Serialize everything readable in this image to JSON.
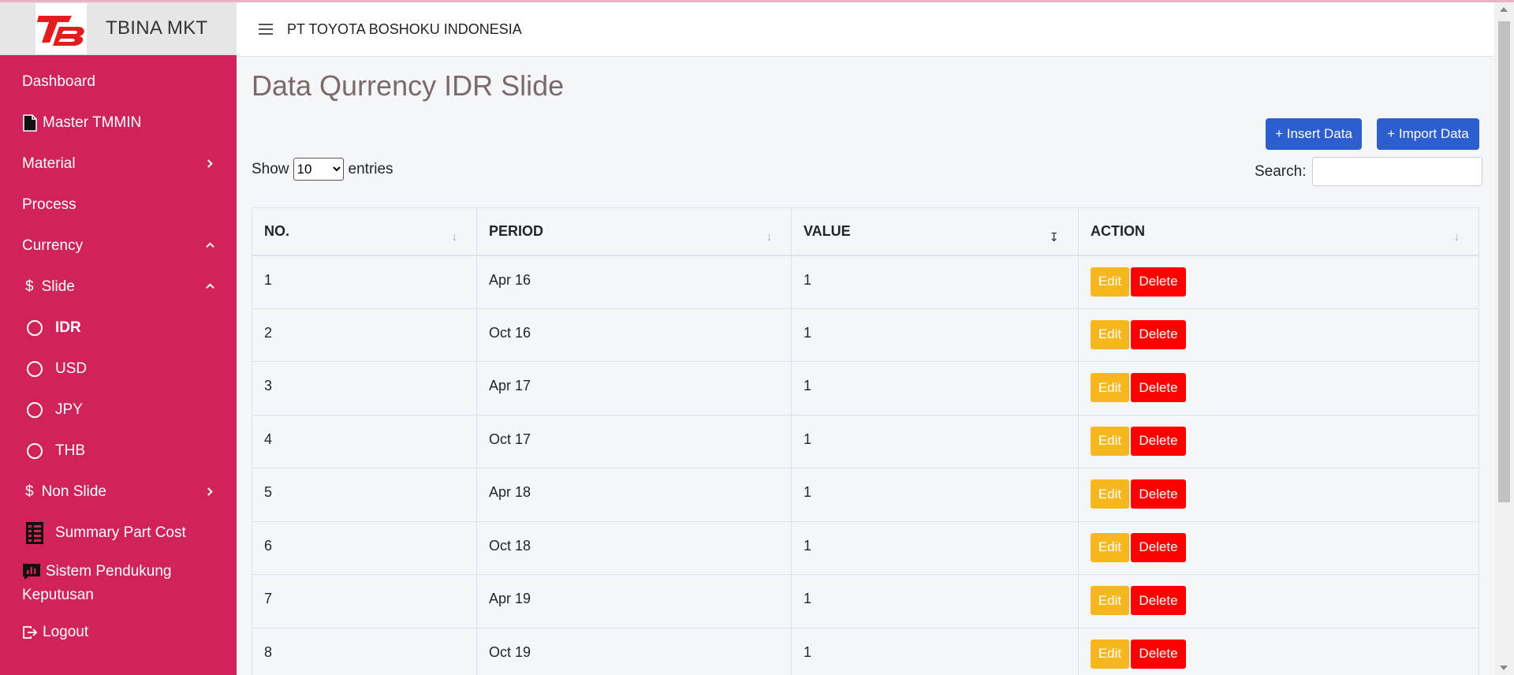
{
  "brand": {
    "title": "TBINA MKT"
  },
  "header": {
    "company": "PT TOYOTA BOSHOKU INDONESIA"
  },
  "sidebar": {
    "dashboard": "Dashboard",
    "master": "Master TMMIN",
    "material": "Material",
    "process": "Process",
    "currency": "Currency",
    "slide": "Slide",
    "slide_items": [
      "IDR",
      "USD",
      "JPY",
      "THB"
    ],
    "active_item": "IDR",
    "non_slide": "Non Slide",
    "summary": "Summary Part Cost",
    "spk_line1": "Sistem Pendukung",
    "spk_line2": "Keputusan",
    "logout": "Logout",
    "dollar_symbol": "$"
  },
  "main": {
    "title": "Data Qurrency IDR Slide",
    "insert_label": "+ Insert Data",
    "import_label": "+ Import Data",
    "show_label": "Show",
    "entries_label": "entries",
    "entries_value": "10",
    "search_label": "Search:",
    "columns": [
      "NO.",
      "PERIOD",
      "VALUE",
      "ACTION"
    ],
    "edit_label": "Edit",
    "delete_label": "Delete",
    "rows": [
      {
        "no": "1",
        "period": "Apr 16",
        "value": "1"
      },
      {
        "no": "2",
        "period": "Oct 16",
        "value": "1"
      },
      {
        "no": "3",
        "period": "Apr 17",
        "value": "1"
      },
      {
        "no": "4",
        "period": "Oct 17",
        "value": "1"
      },
      {
        "no": "5",
        "period": "Apr 18",
        "value": "1"
      },
      {
        "no": "6",
        "period": "Oct 18",
        "value": "1"
      },
      {
        "no": "7",
        "period": "Apr 19",
        "value": "1"
      },
      {
        "no": "8",
        "period": "Oct 19",
        "value": "1"
      }
    ]
  },
  "colors": {
    "sidebar": "#cf2359",
    "primary": "#2d5ecf",
    "edit": "#f7b71e",
    "delete": "#ff0000"
  }
}
